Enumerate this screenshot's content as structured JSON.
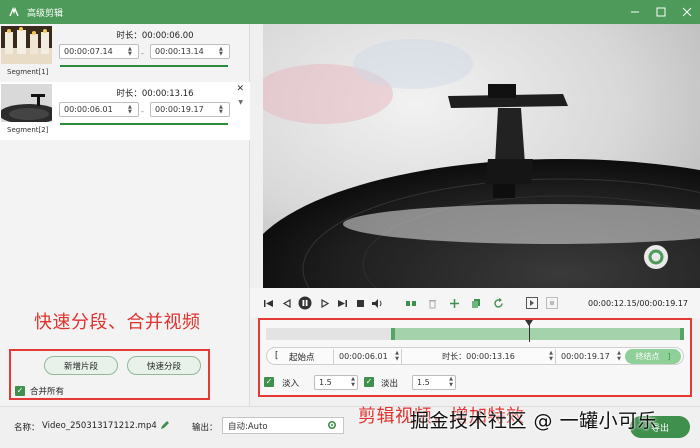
{
  "window": {
    "title": "高级剪辑",
    "icon": "app-logo-icon",
    "controls": [
      "minimize-icon",
      "maximize-icon",
      "close-icon"
    ]
  },
  "segments": [
    {
      "label": "Segment[1]",
      "duration_label": "时长：00:00:06.00",
      "start": "00:00:07.14",
      "end": "00:00:13.14",
      "separator": "-"
    },
    {
      "label": "Segment[2]",
      "duration_label": "时长：00:00:13.16",
      "start": "00:00:06.01",
      "end": "00:00:19.17",
      "separator": "-"
    }
  ],
  "annotations": {
    "left": "快速分段、合并视频",
    "right": "剪辑视频，增加特效"
  },
  "segment_actions": {
    "add_segment": "新增片段",
    "quick_split": "快速分段",
    "merge_all": "合并所有"
  },
  "player": {
    "time_display": "00:00:12.15/00:00:19.17",
    "icons": [
      "to-start-icon",
      "prev-frame-icon",
      "pause-icon",
      "next-frame-icon",
      "to-end-icon",
      "stop-icon",
      "volume-icon",
      "split-icon",
      "delete-icon",
      "add-icon",
      "copy-icon",
      "rotate-icon",
      "mark-in-icon",
      "mark-out-icon"
    ]
  },
  "timeline": {
    "selection_start_fraction": 0.3,
    "selection_end_fraction": 1.0,
    "playhead_fraction": 0.63,
    "start_label": "起始点",
    "start_value": "00:00:06.01",
    "duration_label": "时长：00:00:13.16",
    "end_value": "00:00:19.17",
    "end_button": "终结点",
    "fade_in_label": "淡入",
    "fade_in_value": "1.5",
    "fade_out_label": "淡出",
    "fade_out_value": "1.5"
  },
  "bottom": {
    "name_label": "名称：",
    "name_value": "Video_250313171212.mp4",
    "output_label": "输出：",
    "output_value": "自动:Auto",
    "export_button": "导出"
  },
  "watermark": "掘金技术社区 @ 一罐小可乐",
  "colors": {
    "accent": "#4e9a5a",
    "annotation_red": "#e53935"
  }
}
